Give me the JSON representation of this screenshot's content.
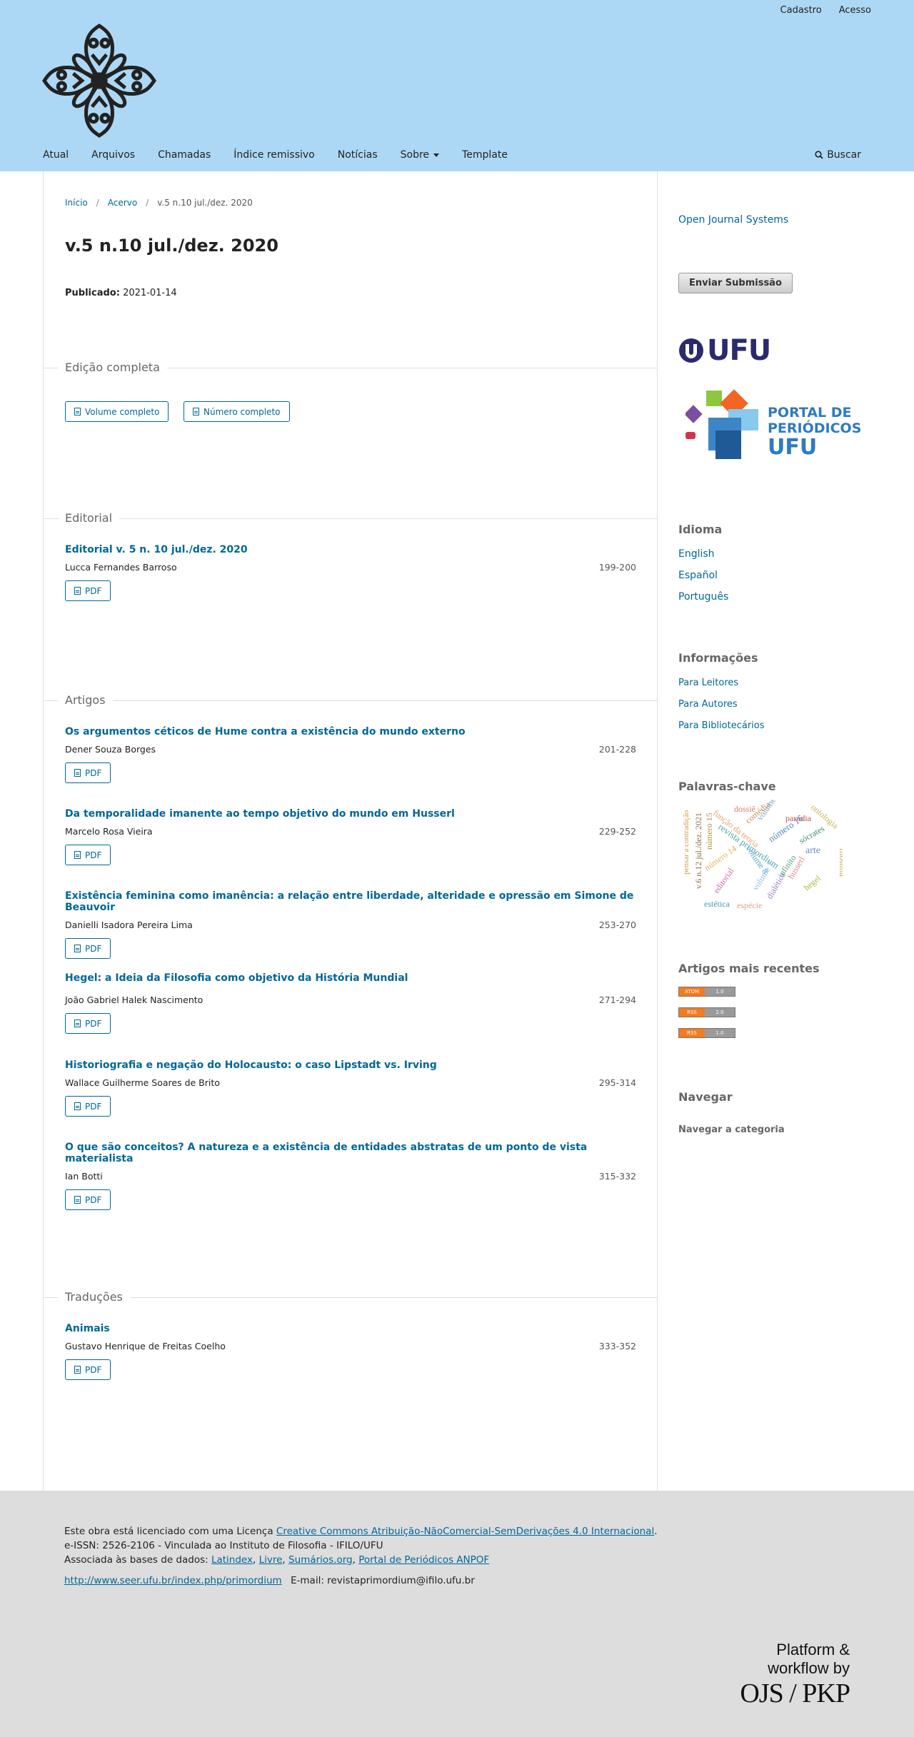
{
  "header": {
    "user_nav": [
      "Cadastro",
      "Acesso"
    ],
    "nav": [
      {
        "label": "Atual"
      },
      {
        "label": "Arquivos"
      },
      {
        "label": "Chamadas"
      },
      {
        "label": "Índice remissivo"
      },
      {
        "label": "Notícias"
      },
      {
        "label": "Sobre",
        "dropdown": true
      },
      {
        "label": "Template"
      }
    ],
    "search_label": "Buscar"
  },
  "breadcrumb": [
    "Início",
    "Acervo",
    "v.5 n.10 jul./dez. 2020"
  ],
  "issue": {
    "title": "v.5 n.10 jul./dez. 2020",
    "published_label": "Publicado:",
    "published_date": "2021-01-14"
  },
  "sections": {
    "full": {
      "label": "Edição completa",
      "buttons": [
        "Volume completo",
        "Número completo"
      ]
    },
    "editorial": {
      "label": "Editorial",
      "articles": [
        {
          "title": "Editorial v. 5 n. 10 jul./dez. 2020",
          "author": "Lucca Fernandes Barroso",
          "pages": "199-200",
          "galley": "PDF"
        }
      ]
    },
    "artigos": {
      "label": "Artigos",
      "articles": [
        {
          "title": "Os argumentos céticos de Hume contra a existência do mundo externo",
          "author": "Dener Souza Borges",
          "pages": "201-228",
          "galley": "PDF"
        },
        {
          "title": "Da temporalidade imanente ao tempo objetivo do mundo em Husserl",
          "author": "Marcelo Rosa Vieira",
          "pages": "229-252",
          "galley": "PDF"
        },
        {
          "title": "Existência feminina como imanência: a relação entre liberdade, alteridade e opressão em Simone de Beauvoir",
          "author": "Danielli Isadora Pereira Lima",
          "pages": "253-270",
          "galley": "PDF"
        },
        {
          "title": "Hegel: a Ideia da Filosofia como objetivo da História Mundial",
          "author": "João Gabriel Halek Nascimento",
          "pages": "271-294",
          "galley": "PDF"
        },
        {
          "title": "Historiografia e negação do Holocausto: o caso Lipstadt vs. Irving",
          "author": "Wallace Guilherme Soares de Brito",
          "pages": "295-314",
          "galley": "PDF"
        },
        {
          "title": "O que são conceitos? A natureza e a existência de entidades abstratas de um ponto de vista materialista",
          "author": "Ian Botti",
          "pages": "315-332",
          "galley": "PDF"
        }
      ]
    },
    "traducoes": {
      "label": "Traduções",
      "articles": [
        {
          "title": "Animais",
          "author": "Gustavo Henrique de Freitas Coelho",
          "pages": "333-352",
          "galley": "PDF"
        }
      ]
    }
  },
  "sidebar": {
    "ojs_link": "Open Journal Systems",
    "submit_button": "Enviar Submissão",
    "ufu_logo_text": "UFU",
    "portal_logo_text": [
      "PORTAL DE",
      "PERIÓDICOS",
      "UFU"
    ],
    "idioma": {
      "title": "Idioma",
      "items": [
        "English",
        "Español",
        "Português"
      ]
    },
    "info": {
      "title": "Informações",
      "items": [
        "Para Leitores",
        "Para Autores",
        "Para Bibliotecários"
      ]
    },
    "keywords": {
      "title": "Palavras-chave",
      "words": [
        "dossiê",
        "ontologia",
        "paródia",
        "comédia",
        "número 16",
        "função da teoria",
        "revista primordium",
        "sócrates",
        "volume 9",
        "filosofia",
        "número 14",
        "volume 8",
        "arte",
        "infinito",
        "hegel",
        "husserl",
        "editorial",
        "volume 7",
        "estética",
        "espécie",
        "pensar a contradição",
        "v.6 n.12 jul./dez. 2021",
        "número 15",
        "dialética"
      ]
    },
    "recent": {
      "title": "Artigos mais recentes",
      "feeds": [
        {
          "a": "ATOM",
          "b": "1.0"
        },
        {
          "a": "RSS",
          "b": "2.0"
        },
        {
          "a": "RSS",
          "b": "1.0"
        }
      ]
    },
    "browse": {
      "title": "Navegar",
      "link": "Navegar a categoria"
    }
  },
  "footer": {
    "license_prefix": "Este obra está licenciado com uma Licença ",
    "license_link": "Creative Commons Atribuição-NãoComercial-SemDerivações 4.0 Internacional",
    "license_suffix": ".",
    "issn_line": "e-ISSN: 2526-2106 - Vinculada ao  Instituto de Filosofia - IFILO/UFU",
    "indexed_prefix": "Associada às bases de dados:  ",
    "indexes": [
      "Latindex",
      "Livre",
      "Sumários.org",
      "Portal de Periódicos ANPOF"
    ],
    "url": "http://www.seer.ufu.br/index.php/primordium",
    "email": "E-mail: revistaprimordium@ifilo.ufu.br",
    "platform_lines": [
      "Platform &",
      "workflow by"
    ],
    "platform_brand": "OJS / PKP"
  },
  "colors": {
    "header_bg": "#add8f5",
    "link": "#006798",
    "footer_bg": "#dddddd"
  }
}
